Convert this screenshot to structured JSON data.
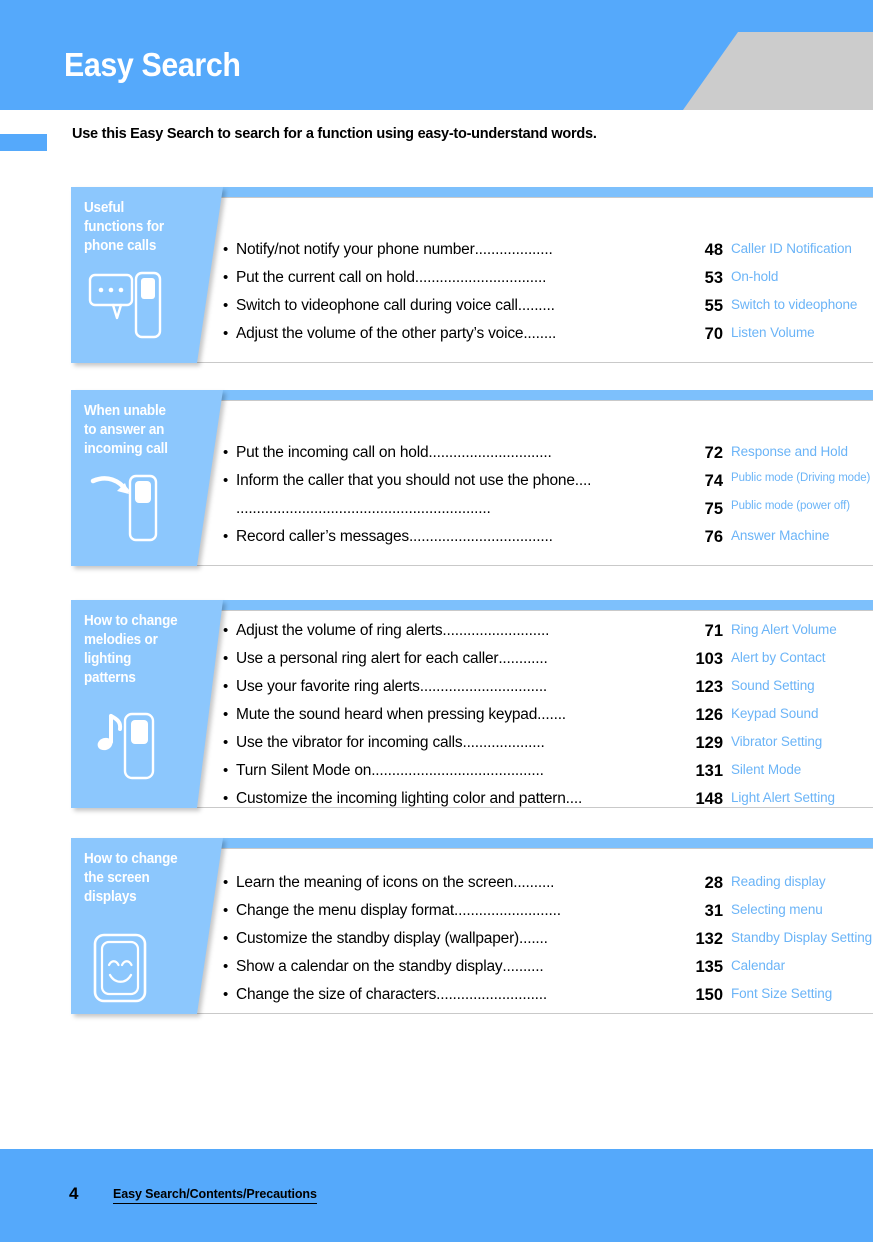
{
  "header": {
    "title": "Easy Search"
  },
  "intro": {
    "text": "Use this Easy Search to search for a function using easy-to-understand words."
  },
  "colors": {
    "header_blue": "#55a9fb",
    "tab_blue": "#8cc7fd",
    "topbar_blue": "#7dc0fc",
    "label_blue": "#6bb4f7",
    "wedge_gray": "#cccccc",
    "panel_border": "#c9c9c9"
  },
  "sections": [
    {
      "title": "Useful functions for phone calls",
      "icon": "speech-bubble-and-phone-icon",
      "entries": [
        {
          "text": "Notify/not notify your phone number",
          "dots": "...................",
          "page": "48",
          "label": "Caller ID Notification",
          "label_small": false
        },
        {
          "text": "Put the current call on hold",
          "dots": "................................",
          "page": "53",
          "label": "On-hold",
          "label_small": false
        },
        {
          "text": "Switch to videophone call during voice call",
          "dots": ".........",
          "page": "55",
          "label": "Switch to videophone",
          "label_small": false
        },
        {
          "text": "Adjust the volume of the other party’s voice",
          "dots": "........",
          "page": "70",
          "label": "Listen Volume",
          "label_small": false
        }
      ]
    },
    {
      "title": "When unable to answer an incoming call",
      "icon": "arrow-into-phone-icon",
      "entries": [
        {
          "text": "Put the incoming call on hold",
          "dots": "..............................",
          "page": "72",
          "label": "Response and Hold",
          "label_small": false
        },
        {
          "text": "Inform the caller that you should not use the phone",
          "dots": " ....",
          "page": "74",
          "label": "Public mode (Driving mode)",
          "label_small": true
        },
        {
          "text": "",
          "dots": "..............................................................",
          "page": "75",
          "label": "Public mode (power off)",
          "label_small": true
        },
        {
          "text": "Record caller’s messages",
          "dots": " ...................................",
          "page": "76",
          "label": "Answer Machine",
          "label_small": false
        }
      ]
    },
    {
      "title": "How to change melodies or lighting patterns",
      "icon": "music-note-and-phone-icon",
      "entries": [
        {
          "text": "Adjust the volume of ring alerts",
          "dots": " ..........................",
          "page": "71",
          "label": "Ring Alert Volume",
          "label_small": false
        },
        {
          "text": "Use a personal ring alert for each caller",
          "dots": "............",
          "page": "103",
          "label": "Alert by Contact",
          "label_small": false
        },
        {
          "text": "Use your favorite ring alerts",
          "dots": "...............................",
          "page": "123",
          "label": "Sound Setting",
          "label_small": false
        },
        {
          "text": "Mute the sound heard when pressing keypad",
          "dots": ".......",
          "page": "126",
          "label": "Keypad Sound",
          "label_small": false
        },
        {
          "text": "Use the vibrator for incoming calls",
          "dots": " ....................",
          "page": "129",
          "label": "Vibrator Setting",
          "label_small": false
        },
        {
          "text": "Turn Silent Mode on",
          "dots": " ..........................................",
          "page": "131",
          "label": "Silent Mode",
          "label_small": false
        },
        {
          "text": "Customize the incoming lighting color and pattern",
          "dots": " ....",
          "page": "148",
          "label": "Light Alert Setting",
          "label_small": false
        }
      ]
    },
    {
      "title": "How to change the screen displays",
      "icon": "smiley-face-phone-icon",
      "entries": [
        {
          "text": "Learn the meaning of icons on the screen",
          "dots": " ..........",
          "page": "28",
          "label": "Reading display",
          "label_small": false
        },
        {
          "text": "Change the menu display format",
          "dots": "..........................",
          "page": "31",
          "label": "Selecting menu",
          "label_small": false
        },
        {
          "text": "Customize the standby display (wallpaper)",
          "dots": " .......",
          "page": "132",
          "label": "Standby Display Setting",
          "label_small": false
        },
        {
          "text": "Show a calendar on the standby display ",
          "dots": " ..........",
          "page": "135",
          "label": "Calendar",
          "label_small": false
        },
        {
          "text": "Change the size of characters",
          "dots": "...........................",
          "page": "150",
          "label": "Font Size Setting",
          "label_small": false
        }
      ]
    }
  ],
  "footer": {
    "page_number": "4",
    "breadcrumb": "Easy Search/Contents/Precautions"
  }
}
